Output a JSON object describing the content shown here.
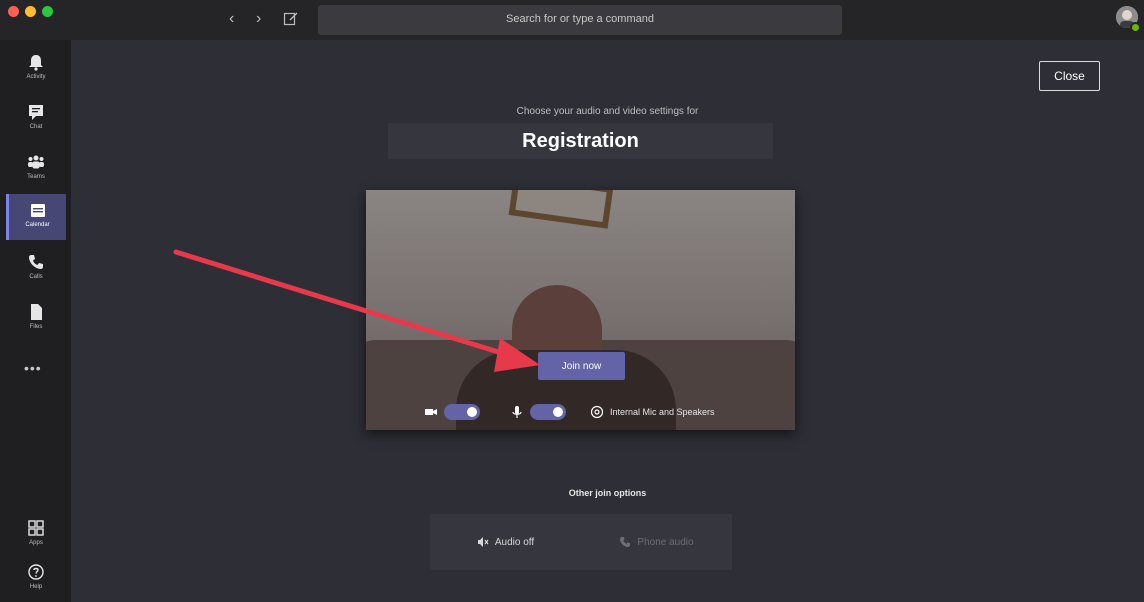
{
  "search": {
    "placeholder": "Search for or type a command"
  },
  "rail": {
    "items": [
      {
        "label": "Activity",
        "icon": "bell-icon"
      },
      {
        "label": "Chat",
        "icon": "chat-icon"
      },
      {
        "label": "Teams",
        "icon": "teams-icon"
      },
      {
        "label": "Calendar",
        "icon": "calendar-icon",
        "active": true
      },
      {
        "label": "Calls",
        "icon": "phone-icon"
      },
      {
        "label": "Files",
        "icon": "file-icon"
      }
    ],
    "more": "•••",
    "bottom": [
      {
        "label": "Apps",
        "icon": "apps-icon"
      },
      {
        "label": "Help",
        "icon": "help-icon"
      }
    ]
  },
  "main": {
    "close_label": "Close",
    "choose_text": "Choose your audio and video settings for",
    "meeting_title": "Registration",
    "join_label": "Join now",
    "device_label": "Internal Mic and Speakers",
    "other_options_label": "Other join options",
    "audio_off_label": "Audio off",
    "phone_audio_label": "Phone audio"
  },
  "colors": {
    "accent": "#6264a7",
    "annotation_arrow": "#e8394b"
  }
}
